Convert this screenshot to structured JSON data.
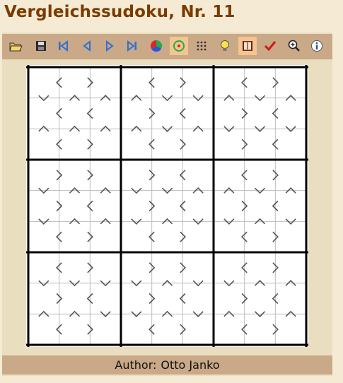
{
  "title": "Vergleichssudoku, Nr. 11",
  "footer": {
    "author_label": "Author:",
    "author_name": "Otto Janko"
  },
  "toolbar": {
    "buttons": [
      {
        "name": "open-icon",
        "active": false
      },
      {
        "name": "save-icon",
        "active": false
      },
      {
        "name": "first-icon",
        "active": false
      },
      {
        "name": "prev-icon",
        "active": false
      },
      {
        "name": "next-icon",
        "active": false
      },
      {
        "name": "last-icon",
        "active": false
      },
      {
        "name": "color-wheel-icon",
        "active": false
      },
      {
        "name": "target-icon",
        "active": true
      },
      {
        "name": "grid-dots-icon",
        "active": false
      },
      {
        "name": "hint-bulb-icon",
        "active": false
      },
      {
        "name": "book-icon",
        "active": true
      },
      {
        "name": "check-icon",
        "active": false
      },
      {
        "name": "zoom-in-icon",
        "active": false
      },
      {
        "name": "info-icon",
        "active": false
      }
    ]
  },
  "puzzle": {
    "size": 9,
    "horizontal_comparisons": [
      [
        "<",
        ">",
        "",
        "<",
        ">",
        "",
        "<",
        ">"
      ],
      [
        "<",
        "<",
        "",
        ">",
        "<",
        "",
        ">",
        "<"
      ],
      [
        "<",
        ">",
        "",
        "<",
        ">",
        "",
        ">",
        "<"
      ],
      [
        ">",
        ">",
        "",
        ">",
        "<",
        "",
        "<",
        ">"
      ],
      [
        ">",
        "<",
        "",
        ">",
        "<",
        "",
        ">",
        "<"
      ],
      [
        "<",
        ">",
        "",
        "<",
        ">",
        "",
        "<",
        ">"
      ],
      [
        "<",
        ">",
        "",
        ">",
        ">",
        "",
        "<",
        ">"
      ],
      [
        ">",
        "<",
        "",
        ">",
        "<",
        "",
        ">",
        "<"
      ],
      [
        "<",
        ">",
        "",
        "<",
        ">",
        "",
        "<",
        ">"
      ]
    ],
    "vertical_comparisons": [
      [
        "v",
        "^",
        "^",
        "^",
        "v",
        "v",
        "^",
        "v",
        "^"
      ],
      [
        "^",
        "^",
        "^",
        "^",
        "v",
        "^",
        "v",
        "v",
        "v"
      ],
      [
        "",
        "",
        "",
        "",
        "",
        "",
        "",
        "",
        ""
      ],
      [
        "v",
        "^",
        "^",
        "v",
        "v",
        "^",
        "^",
        "v",
        "^"
      ],
      [
        "v",
        "^",
        "^",
        "v",
        "^",
        "v",
        "v",
        "^",
        "v"
      ],
      [
        "",
        "",
        "",
        "",
        "",
        "",
        "",
        "",
        ""
      ],
      [
        "v",
        "v",
        "v",
        "v",
        "^",
        "v",
        "v",
        "^",
        "^"
      ],
      [
        "^",
        "^",
        "v",
        "v",
        "^",
        "v",
        "^",
        "v",
        "^"
      ]
    ]
  }
}
